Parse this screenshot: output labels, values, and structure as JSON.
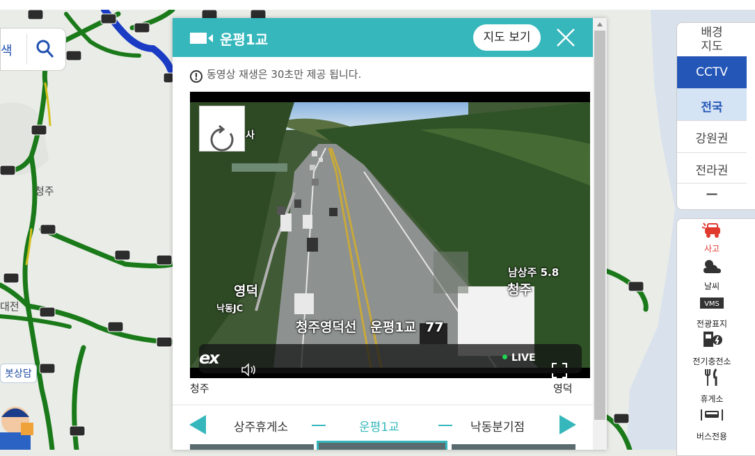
{
  "map": {
    "labels": {
      "cheongju": "청주",
      "daejeon": "대전"
    },
    "search_label": "색",
    "dam_tag": "봇상담"
  },
  "modal": {
    "title": "운평1교",
    "map_button": "지도 보기",
    "notice": "동영상 재생은 30초만 제공 됩니다.",
    "video": {
      "overlay_left_name": "사",
      "overlay_youngdeok": "영덕",
      "overlay_nakdongjc": "낙동JC",
      "overlay_namsangju": "남상주 5.8",
      "overlay_cheongju": "청주",
      "overlay_caption": "청주영덕선   운평1교  77",
      "logo": "ex",
      "live": "LIVE"
    },
    "direction_left": "청주",
    "direction_right": "영덕",
    "nav": {
      "prev": "상주휴게소",
      "current": "운평1교",
      "next": "낙동분기점"
    }
  },
  "side_panel": {
    "basemap": "배경\n지도",
    "cctv": "CCTV",
    "regions": [
      "전국",
      "강원권",
      "전라권"
    ],
    "collapse": "—",
    "layers": [
      {
        "label": "사고",
        "icon": "accident-icon",
        "color": "#e03a2f"
      },
      {
        "label": "날씨",
        "icon": "weather-icon"
      },
      {
        "label": "전광표지",
        "icon": "vms-icon"
      },
      {
        "label": "전기충전소",
        "icon": "ev-charger-icon"
      },
      {
        "label": "휴게소",
        "icon": "rest-area-icon"
      },
      {
        "label": "버스전용",
        "icon": "bus-lane-icon"
      }
    ]
  },
  "colors": {
    "accent": "#36b7bc",
    "brand_blue": "#2456b8"
  }
}
